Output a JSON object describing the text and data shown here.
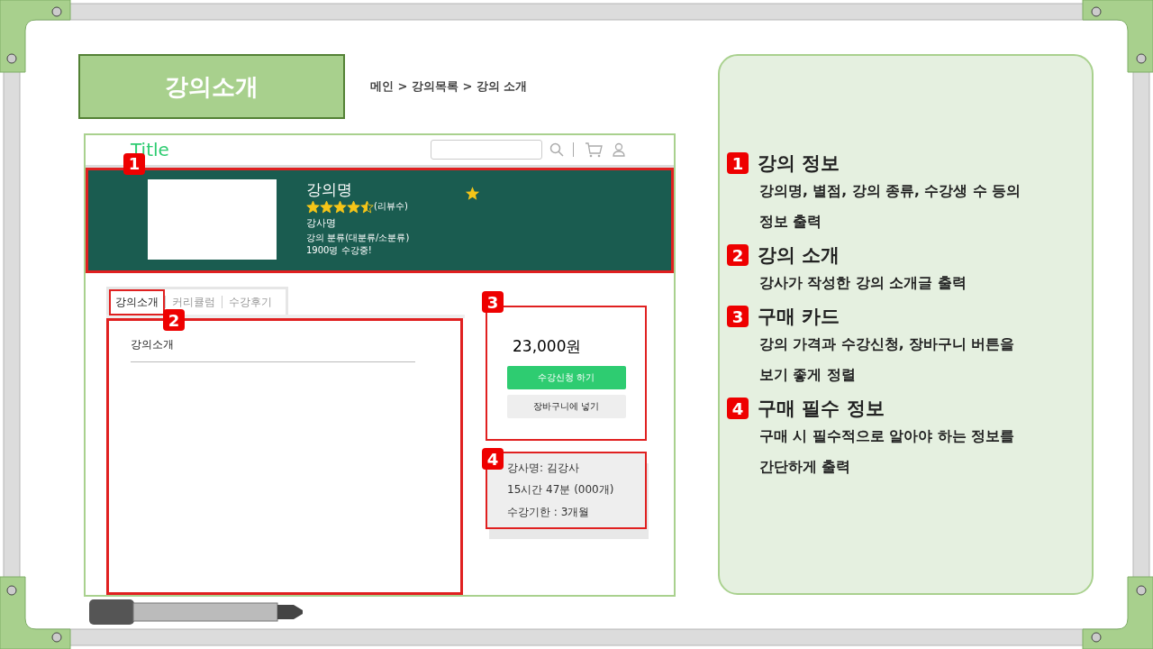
{
  "slide_title": "강의소개",
  "breadcrumb": "메인 > 강의목록 > 강의 소개",
  "wireframe": {
    "logo": "Title",
    "hero": {
      "badge": "1",
      "course_name": "강의명",
      "stars": 4.5,
      "review_count": "(리뷰수)",
      "instructor": "강사명",
      "category": "강의 분류(대분류/소분류)",
      "enrollment": "1900명 수강중!"
    },
    "tabs": [
      {
        "label": "강의소개",
        "selected": true
      },
      {
        "label": "커리큘럼",
        "selected": false
      },
      {
        "label": "수강후기",
        "selected": false
      }
    ],
    "tabs_badge": "2",
    "content": {
      "heading": "강의소개"
    },
    "purchase_card": {
      "badge": "3",
      "price": "23,000원",
      "buttons": [
        {
          "label": "수강신청 하기",
          "kind": "primary"
        },
        {
          "label": "장바구니에 넣기",
          "kind": "secondary"
        }
      ]
    },
    "info_card": {
      "badge": "4",
      "lines": [
        "강사명: 김강사",
        "15시간 47분 (000개)",
        "수강기한 : 3개월"
      ]
    }
  },
  "legend": [
    {
      "number": "1",
      "title": "강의 정보",
      "description": "강의명, 별점, 강의 종류, 수강생 수 등의 정보 출력"
    },
    {
      "number": "2",
      "title": "강의 소개",
      "description": "강사가 작성한 강의 소개글 출력"
    },
    {
      "number": "3",
      "title": "구매 카드",
      "description": "강의 가격과 수강신청, 장바구니 버튼을 보기 좋게 정렬"
    },
    {
      "number": "4",
      "title": "구매 필수 정보",
      "description": "구매 시 필수적으로 알아야 하는 정보를 간단하게 출력"
    }
  ]
}
